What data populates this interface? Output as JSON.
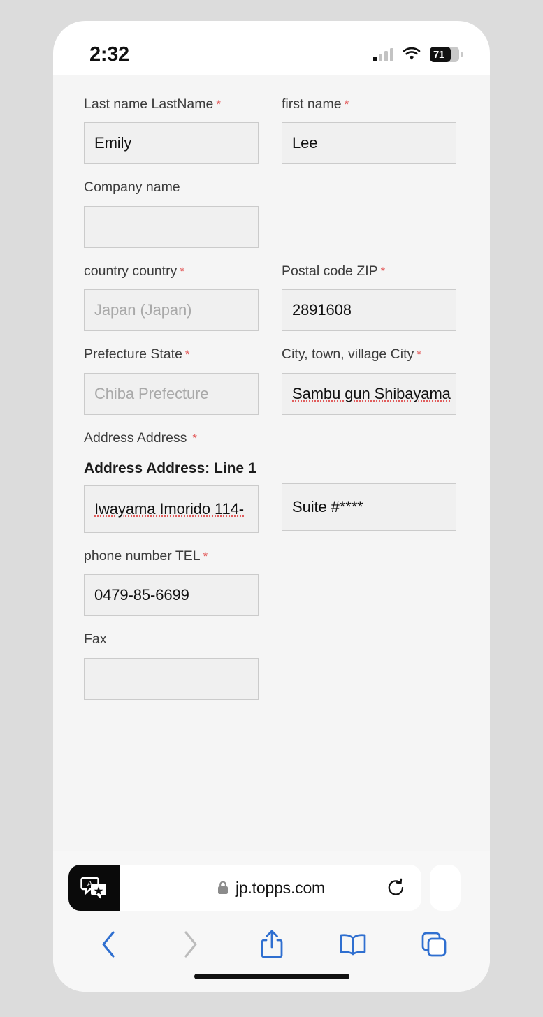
{
  "status_bar": {
    "time": "2:32",
    "signal_icon": "cellular-signal-icon",
    "wifi_icon": "wifi-icon",
    "battery_level": "71",
    "battery_icon": "battery-icon"
  },
  "form": {
    "rows": [
      {
        "left": {
          "label": "Last name LastName",
          "required": "*",
          "value": "Emily",
          "is_placeholder": false,
          "misspelled": false
        },
        "right": {
          "label": "first name",
          "required": "*",
          "value": "Lee",
          "is_placeholder": false,
          "misspelled": false
        }
      },
      {
        "left": {
          "label": "Company name",
          "required": "",
          "value": "",
          "is_placeholder": false,
          "misspelled": false
        },
        "right": null
      },
      {
        "left": {
          "label": "country country",
          "required": "*",
          "value": "Japan (Japan)",
          "is_placeholder": true,
          "misspelled": false
        },
        "right": {
          "label": "Postal code ZIP",
          "required": "*",
          "value": "2891608",
          "is_placeholder": false,
          "misspelled": false
        }
      },
      {
        "left": {
          "label": "Prefecture State",
          "required": "*",
          "value": "Chiba Prefecture",
          "is_placeholder": true,
          "misspelled": false
        },
        "right": {
          "label": "City, town, village City",
          "required": "*",
          "value": "Sambu gun Shibayama",
          "is_placeholder": false,
          "misspelled": true
        }
      }
    ],
    "address": {
      "group_label": "Address Address",
      "group_required": "*",
      "line1_label": "Address Address: Line 1",
      "line1_value": "Iwayama Imorido 114-",
      "line2_value": "Suite #****"
    },
    "phone": {
      "label": "phone number TEL",
      "required": "*",
      "value": "0479-85-6699"
    },
    "fax": {
      "label": "Fax",
      "required": "",
      "value": ""
    }
  },
  "browser": {
    "translate_icon": "translate-icon",
    "lock_icon": "lock-icon",
    "url": "jp.topps.com",
    "reload_icon": "reload-icon",
    "toolbar": {
      "back_icon": "back-chevron-icon",
      "forward_icon": "forward-chevron-icon",
      "share_icon": "share-icon",
      "bookmarks_icon": "book-icon",
      "tabs_icon": "tabs-icon"
    }
  },
  "colors": {
    "accent_blue": "#2f6fd0",
    "disabled_gray": "#b9b9b9",
    "required_red": "#e35b5b",
    "page_bg": "#f5f5f5",
    "frame_bg": "#dcdcdc"
  }
}
